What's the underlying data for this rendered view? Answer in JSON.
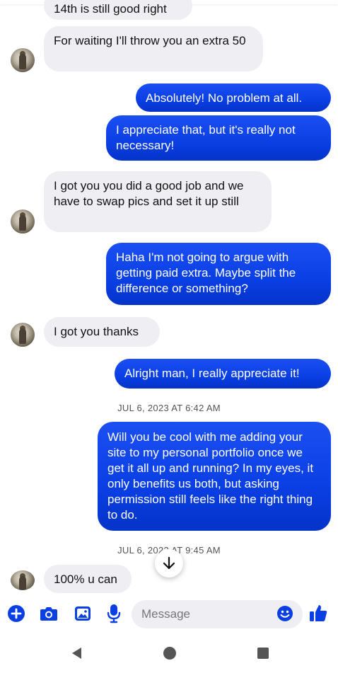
{
  "messages": [
    {
      "id": "m1",
      "dir": "in",
      "text": "14th is still good right"
    },
    {
      "id": "m2",
      "dir": "in",
      "text": "For waiting I'll throw you an extra 50"
    },
    {
      "id": "m3",
      "dir": "out",
      "text": "Absolutely! No problem at all."
    },
    {
      "id": "m4",
      "dir": "out",
      "text": "I appreciate that, but it's really not necessary!"
    },
    {
      "id": "m5",
      "dir": "in",
      "text": "I got you you did a good job and we have to swap pics and set it up still"
    },
    {
      "id": "m6",
      "dir": "out",
      "text": "Haha I'm not going to argue with getting paid extra. Maybe split the difference or something?"
    },
    {
      "id": "m7",
      "dir": "in",
      "text": "I got you thanks"
    },
    {
      "id": "m8",
      "dir": "out",
      "text": "Alright man, I really appreciate it!"
    },
    {
      "id": "m9",
      "dir": "out",
      "text": "Will you be cool with me adding your site to my personal portfolio once we get it all up and running? In my eyes, it only benefits us both, but asking permission still feels like the right thing to do."
    },
    {
      "id": "m10",
      "dir": "in",
      "text": "100% u can"
    }
  ],
  "timestamps": {
    "t1": "JUL 6, 2023 AT 6:42 AM",
    "t2": "JUL 6, 2023 AT 9:45 AM"
  },
  "composer": {
    "placeholder": "Message",
    "icons": [
      "plus-icon",
      "camera-icon",
      "gallery-icon",
      "microphone-icon",
      "emoji-icon",
      "thumbs-up-icon"
    ]
  },
  "colors": {
    "accent": "#0a3fe4",
    "incoming_bubble": "#efeff3",
    "outgoing_text": "#ffffff"
  },
  "navbar": {
    "icons": [
      "back-icon",
      "home-icon",
      "recents-icon"
    ]
  }
}
